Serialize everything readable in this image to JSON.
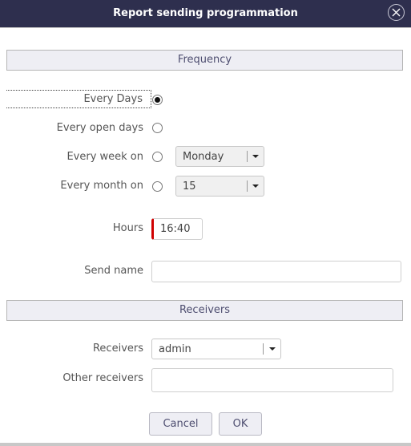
{
  "dialog": {
    "title": "Report sending programmation",
    "close_icon": "close-circle-icon"
  },
  "frequency": {
    "section_title": "Frequency",
    "options": [
      {
        "label": "Every Days",
        "checked": true
      },
      {
        "label": "Every open days",
        "checked": false
      },
      {
        "label": "Every week on",
        "checked": false,
        "select_value": "Monday"
      },
      {
        "label": "Every month on",
        "checked": false,
        "select_value": "15"
      }
    ],
    "hours_label": "Hours",
    "hours_value": "16:40",
    "send_name_label": "Send name",
    "send_name_value": ""
  },
  "receivers": {
    "section_title": "Receivers",
    "receivers_label": "Receivers",
    "receivers_value": "admin",
    "other_label": "Other receivers",
    "other_value": ""
  },
  "buttons": {
    "cancel": "Cancel",
    "ok": "OK"
  },
  "colors": {
    "titlebar": "#2e2f4e",
    "required_marker": "#d00000"
  }
}
